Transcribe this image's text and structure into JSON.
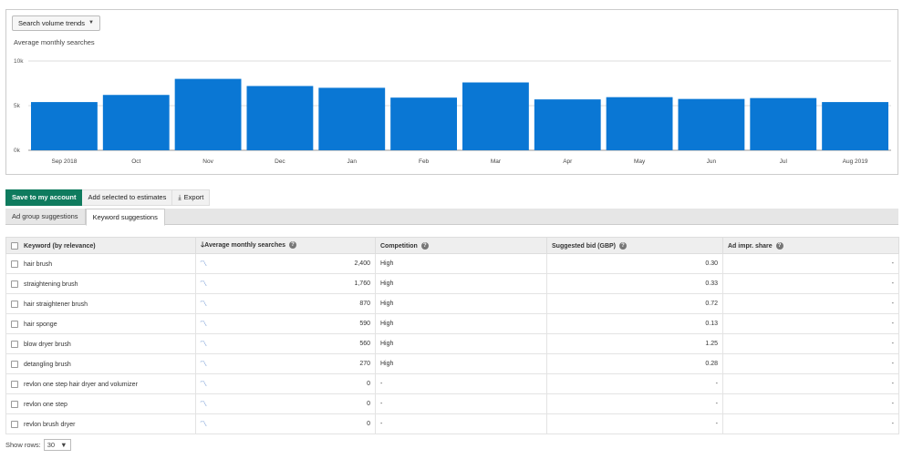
{
  "chart_panel": {
    "dropdown_label": "Search volume trends",
    "subtitle": "Average monthly searches"
  },
  "chart_data": {
    "type": "bar",
    "categories": [
      "Sep 2018",
      "Oct",
      "Nov",
      "Dec",
      "Jan",
      "Feb",
      "Mar",
      "Apr",
      "May",
      "Jun",
      "Jul",
      "Aug 2019"
    ],
    "values": [
      5400,
      6200,
      8000,
      7200,
      7000,
      5900,
      7600,
      5700,
      5950,
      5750,
      5850,
      5400
    ],
    "ylim": [
      0,
      10000
    ],
    "yticks": [
      {
        "value": 0,
        "label": "0k"
      },
      {
        "value": 5000,
        "label": "5k"
      },
      {
        "value": 10000,
        "label": "10k"
      }
    ],
    "grid": true,
    "bar_color": "#0a77d4"
  },
  "toolbar": {
    "save_label": "Save to my account",
    "add_label": "Add selected to estimates",
    "export_label": "Export"
  },
  "tabs": [
    {
      "label": "Ad group suggestions",
      "active": false
    },
    {
      "label": "Keyword suggestions",
      "active": true
    }
  ],
  "table": {
    "headers": {
      "keyword": "Keyword (by relevance)",
      "searches": "Average monthly searches",
      "competition": "Competition",
      "bid": "Suggested bid (GBP)",
      "share": "Ad impr. share"
    },
    "rows": [
      {
        "keyword": "hair brush",
        "searches": "2,400",
        "competition": "High",
        "bid": "0.30",
        "share": "-"
      },
      {
        "keyword": "straightening brush",
        "searches": "1,760",
        "competition": "High",
        "bid": "0.33",
        "share": "-"
      },
      {
        "keyword": "hair straightener brush",
        "searches": "870",
        "competition": "High",
        "bid": "0.72",
        "share": "-"
      },
      {
        "keyword": "hair sponge",
        "searches": "590",
        "competition": "High",
        "bid": "0.13",
        "share": "-"
      },
      {
        "keyword": "blow dryer brush",
        "searches": "560",
        "competition": "High",
        "bid": "1.25",
        "share": "-"
      },
      {
        "keyword": "detangling brush",
        "searches": "270",
        "competition": "High",
        "bid": "0.28",
        "share": "-"
      },
      {
        "keyword": "revlon one step hair dryer and volumizer",
        "searches": "0",
        "competition": "-",
        "bid": "-",
        "share": "-"
      },
      {
        "keyword": "revlon one step",
        "searches": "0",
        "competition": "-",
        "bid": "-",
        "share": "-"
      },
      {
        "keyword": "revlon brush dryer",
        "searches": "0",
        "competition": "-",
        "bid": "-",
        "share": "-"
      }
    ]
  },
  "footer": {
    "show_rows_label": "Show rows:",
    "show_rows_value": "30"
  }
}
